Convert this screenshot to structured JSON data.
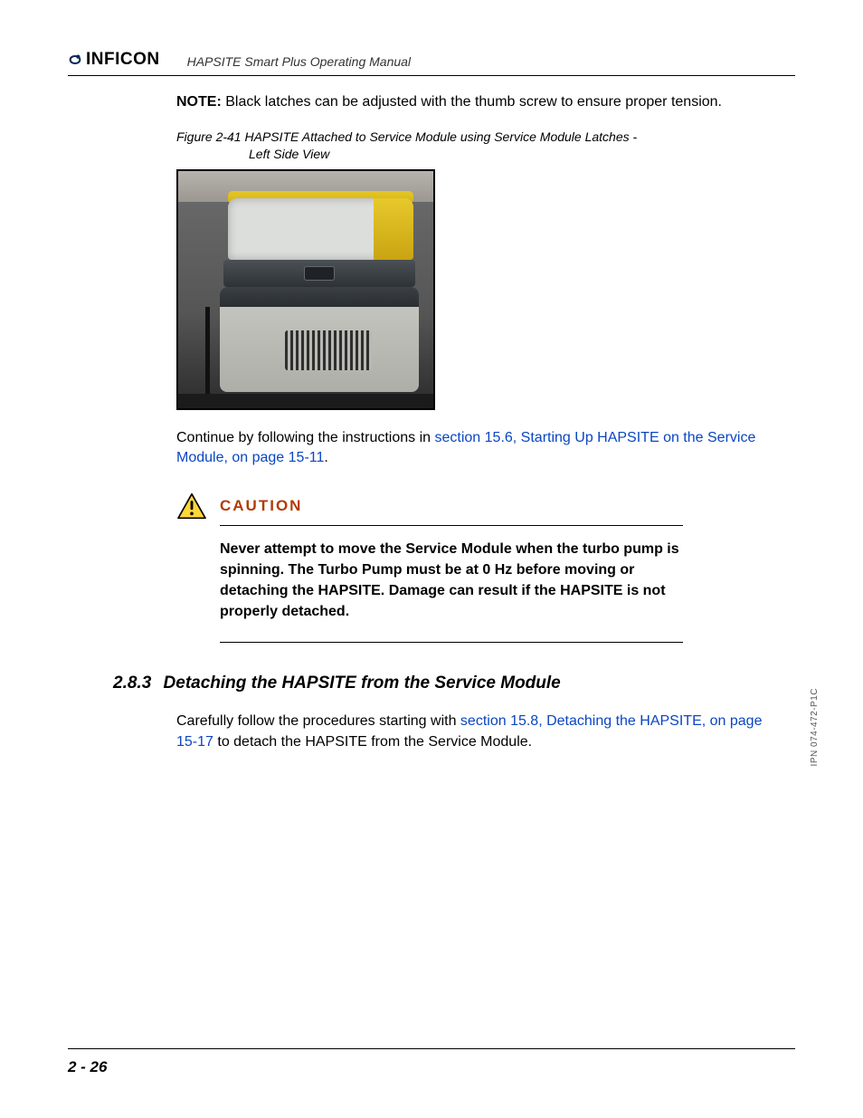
{
  "header": {
    "brand": "INFICON",
    "doc_title": "HAPSITE Smart Plus Operating Manual"
  },
  "note": {
    "label": "NOTE:",
    "text": "Black latches can be adjusted with the thumb screw to ensure proper tension."
  },
  "figure": {
    "caption_line1": "Figure 2-41  HAPSITE Attached to Service Module using Service Module Latches -",
    "caption_line2": "Left Side View",
    "alt": "Photograph: HAPSITE attached to Service Module, left side view"
  },
  "continue_text": {
    "prefix": "Continue by following the instructions in ",
    "link": "section 15.6, Starting Up HAPSITE on the Service Module, on page 15-11",
    "suffix": "."
  },
  "caution": {
    "label": "CAUTION",
    "text": "Never attempt to move the Service Module when the turbo pump is spinning. The Turbo Pump must be at 0 Hz before moving or detaching the HAPSITE. Damage can result if the HAPSITE is not properly detached."
  },
  "section": {
    "number": "2.8.3",
    "title": "Detaching the HAPSITE from the Service Module"
  },
  "section_body": {
    "prefix": "Carefully follow the procedures starting with ",
    "link": "section 15.8, Detaching the HAPSITE, on page 15-17",
    "suffix": " to detach the HAPSITE from the Service Module."
  },
  "footer": {
    "page": "2 - 26"
  },
  "side_code": "IPN 074-472-P1C"
}
